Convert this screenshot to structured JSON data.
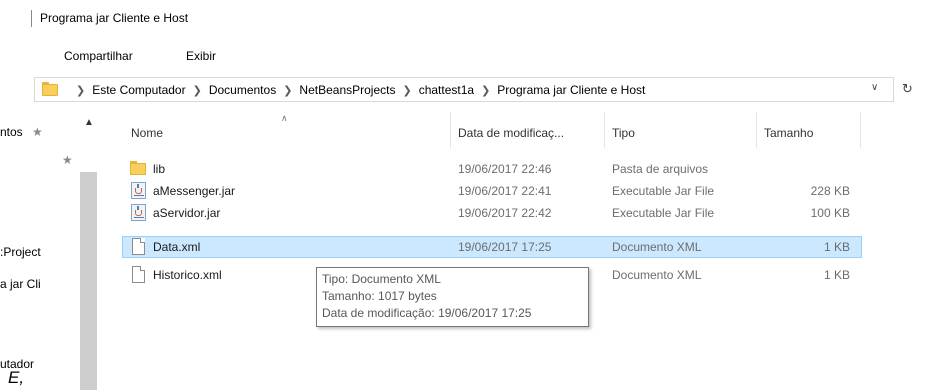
{
  "window": {
    "title": "Programa jar Cliente e Host"
  },
  "ribbon": {
    "tabs": [
      "Compartilhar",
      "Exibir"
    ]
  },
  "address": {
    "crumbs": [
      "Este Computador",
      "Documentos",
      "NetBeansProjects",
      "chattest1a",
      "Programa jar Cliente e Host"
    ]
  },
  "nav": {
    "items": [
      "ntos",
      ":Project",
      "a jar Cli",
      "utador"
    ],
    "bottom_glyph": "E,"
  },
  "columns": {
    "name": "Nome",
    "date": "Data de modificaç...",
    "type": "Tipo",
    "size": "Tamanho"
  },
  "files": [
    {
      "name": "lib",
      "date": "19/06/2017 22:46",
      "type": "Pasta de arquivos",
      "size": "",
      "icon": "folder-icon"
    },
    {
      "name": "aMessenger.jar",
      "date": "19/06/2017 22:41",
      "type": "Executable Jar File",
      "size": "228 KB",
      "icon": "jar-file-icon"
    },
    {
      "name": "aServidor.jar",
      "date": "19/06/2017 22:42",
      "type": "Executable Jar File",
      "size": "100 KB",
      "icon": "jar-file-icon"
    },
    {
      "name": "Data.xml",
      "date": "19/06/2017 17:25",
      "type": "Documento XML",
      "size": "1 KB",
      "icon": "xml-file-icon"
    },
    {
      "name": "Historico.xml",
      "date": "",
      "type": "Documento XML",
      "size": "1 KB",
      "icon": "xml-file-icon"
    }
  ],
  "tooltip": {
    "type": "Tipo: Documento XML",
    "size": "Tamanho: 1017 bytes",
    "date": "Data de modificação: 19/06/2017 17:25"
  },
  "colors": {
    "selection": "#cce8ff",
    "selection_border": "#99d1ff",
    "folder": "#f7cf5a"
  }
}
